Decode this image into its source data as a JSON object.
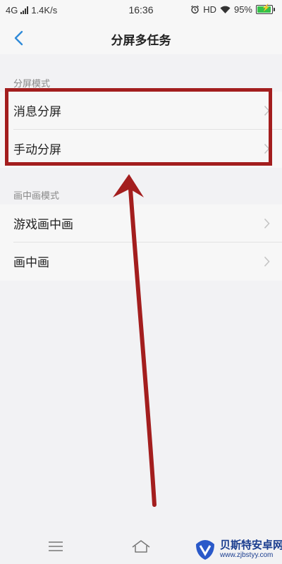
{
  "status_bar": {
    "network": "4G",
    "speed": "1.4K/s",
    "time": "16:36",
    "hd": "HD",
    "battery": "95%",
    "battery_level": 0.95,
    "battery_color": "#35c14a"
  },
  "header": {
    "title": "分屏多任务",
    "back_icon": "chevron-left-icon",
    "accent_color": "#2f8ad8"
  },
  "sections": [
    {
      "header": "分屏模式",
      "items": [
        {
          "label": "消息分屏",
          "icon": "chevron-right-icon"
        },
        {
          "label": "手动分屏",
          "icon": "chevron-right-icon"
        }
      ]
    },
    {
      "header": "画中画模式",
      "items": [
        {
          "label": "游戏画中画",
          "icon": "chevron-right-icon"
        },
        {
          "label": "画中画",
          "icon": "chevron-right-icon"
        }
      ]
    }
  ],
  "annotation": {
    "highlight_color": "#a31e1e",
    "arrow_color": "#a31e1e"
  },
  "nav_bar": {
    "menu_icon": "menu-icon",
    "home_icon": "home-icon"
  },
  "watermark": {
    "name": "贝斯特安卓网",
    "url": "www.zjbstyy.com"
  }
}
